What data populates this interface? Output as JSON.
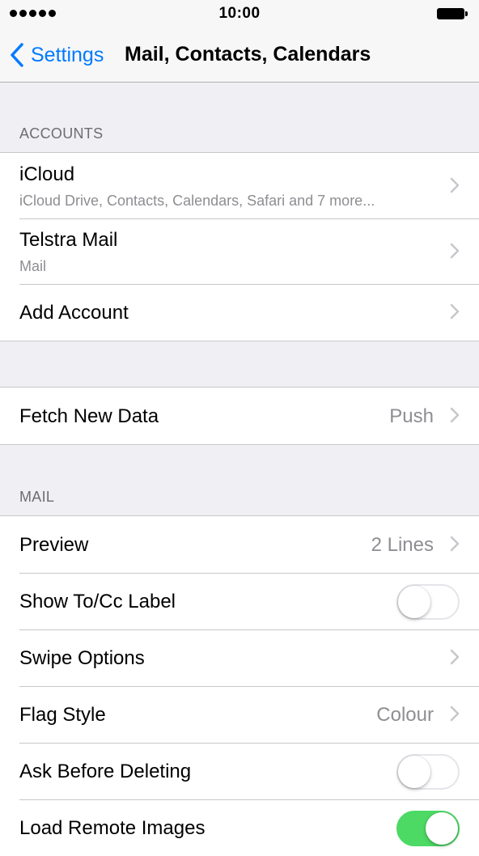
{
  "status_bar": {
    "time": "10:00"
  },
  "nav": {
    "back_label": "Settings",
    "title": "Mail, Contacts, Calendars"
  },
  "accounts": {
    "header": "ACCOUNTS",
    "items": [
      {
        "title": "iCloud",
        "subtitle": "iCloud Drive, Contacts, Calendars, Safari and 7 more..."
      },
      {
        "title": "Telstra Mail",
        "subtitle": "Mail"
      },
      {
        "title": "Add Account"
      }
    ]
  },
  "fetch": {
    "title": "Fetch New Data",
    "value": "Push"
  },
  "mail": {
    "header": "MAIL",
    "preview": {
      "title": "Preview",
      "value": "2 Lines"
    },
    "show_tocc": {
      "title": "Show To/Cc Label",
      "on": false
    },
    "swipe": {
      "title": "Swipe Options"
    },
    "flag": {
      "title": "Flag Style",
      "value": "Colour"
    },
    "ask_delete": {
      "title": "Ask Before Deleting",
      "on": false
    },
    "load_images": {
      "title": "Load Remote Images",
      "on": true
    }
  },
  "colors": {
    "accent": "#007aff",
    "toggle_on": "#4cd964",
    "background": "#efeff4"
  }
}
